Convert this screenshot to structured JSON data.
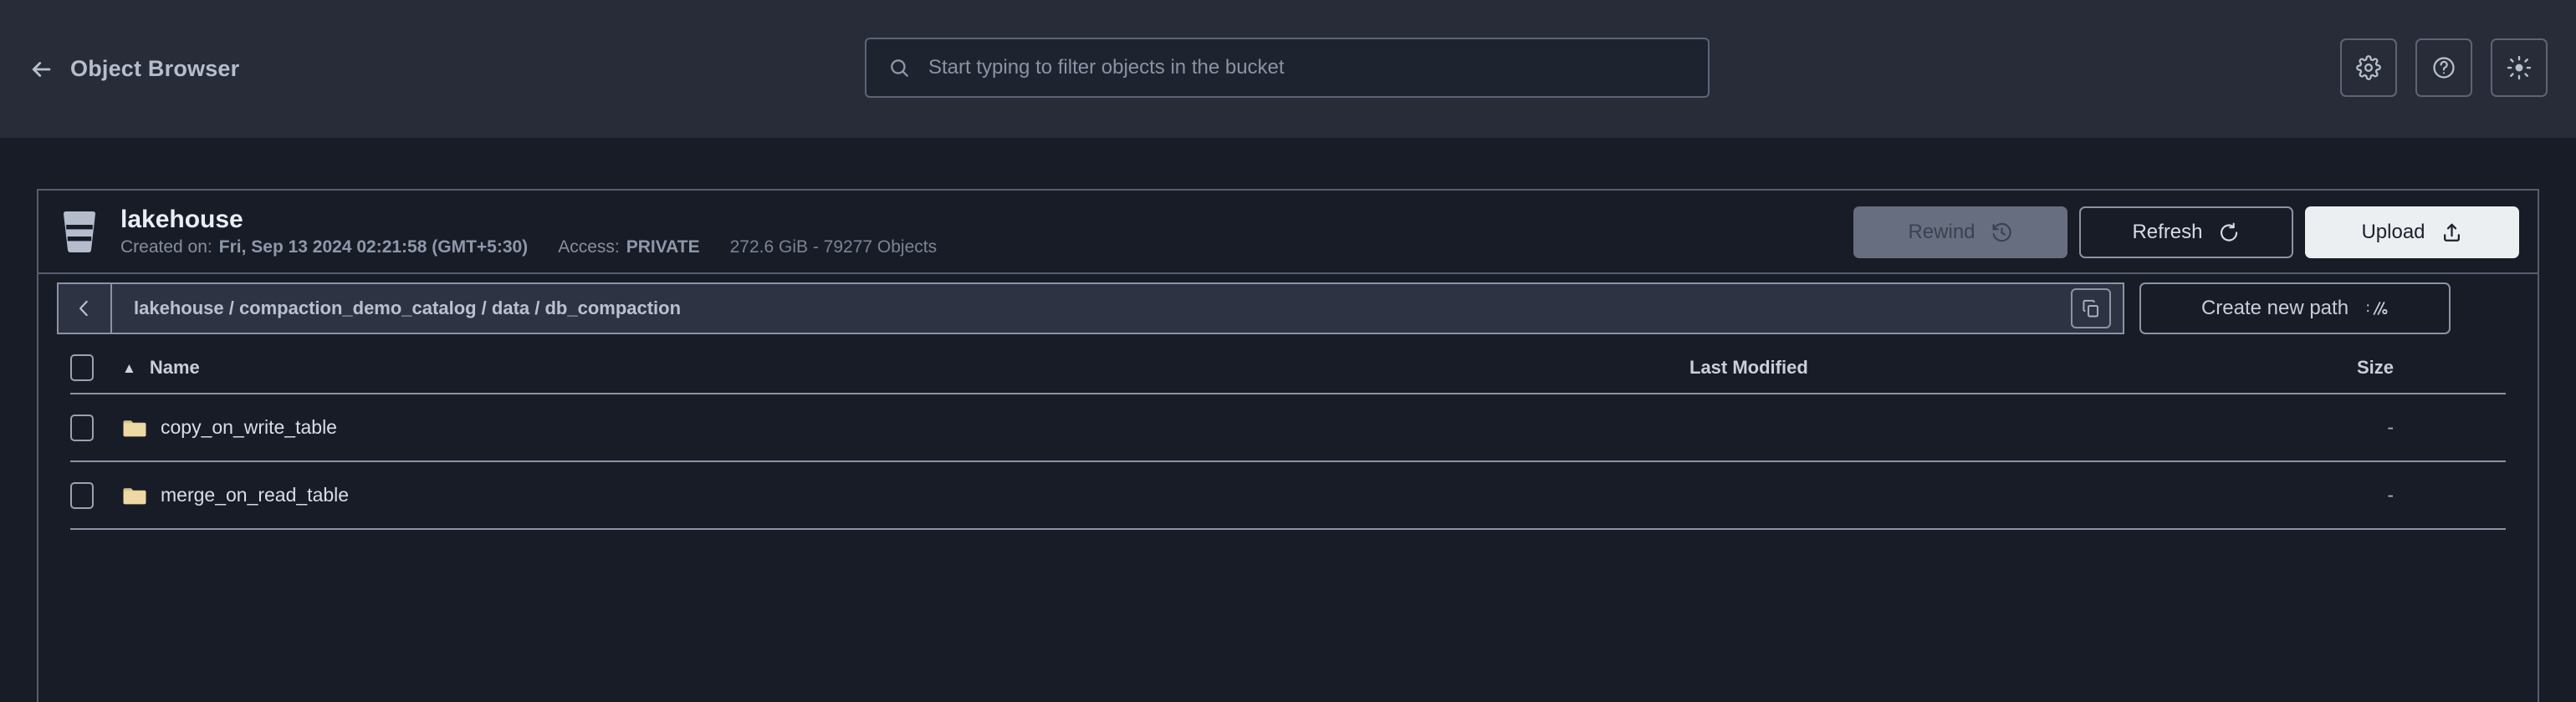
{
  "header": {
    "back_icon": "arrow-left-icon",
    "title": "Object Browser",
    "search": {
      "icon": "search-icon",
      "placeholder": "Start typing to filter objects in the bucket",
      "value": ""
    },
    "actions": [
      {
        "name": "settings",
        "icon": "gear-icon"
      },
      {
        "name": "help",
        "icon": "question-circle-icon"
      },
      {
        "name": "theme",
        "icon": "sun-icon"
      }
    ]
  },
  "bucket": {
    "icon": "bucket-icon",
    "name": "lakehouse",
    "created_label": "Created on:",
    "created_value": "Fri, Sep 13 2024 02:21:58 (GMT+5:30)",
    "access_label": "Access:",
    "access_value": "PRIVATE",
    "usage": "272.6 GiB - 79277 Objects",
    "buttons": {
      "rewind": {
        "label": "Rewind",
        "icon": "rewind-clock-icon",
        "disabled": true
      },
      "refresh": {
        "label": "Refresh",
        "icon": "refresh-icon",
        "disabled": false
      },
      "upload": {
        "label": "Upload",
        "icon": "upload-icon",
        "disabled": false
      }
    }
  },
  "breadcrumb": {
    "back_icon": "chevron-left-icon",
    "path": "lakehouse / compaction_demo_catalog / data / db_compaction",
    "copy_icon": "copy-icon",
    "create_path": {
      "label": "Create new path",
      "icon": "path-slash-icon"
    }
  },
  "table": {
    "select_all_checked": false,
    "sort_column": "Name",
    "sort_direction": "asc",
    "sort_caret": "▲",
    "columns": {
      "name": "Name",
      "last_modified": "Last Modified",
      "size": "Size"
    },
    "rows": [
      {
        "checked": false,
        "icon": "folder-icon",
        "name": "copy_on_write_table",
        "last_modified": "",
        "size": "-"
      },
      {
        "checked": false,
        "icon": "folder-icon",
        "name": "merge_on_read_table",
        "last_modified": "",
        "size": "-"
      }
    ]
  },
  "colors": {
    "topbar_bg": "#272c38",
    "body_bg": "#181c26",
    "border": "#555d70",
    "accent_text": "#b6bdcc",
    "folder": "#e8d59a",
    "upload_bg": "#eceff2",
    "rewind_bg": "#676e80"
  }
}
